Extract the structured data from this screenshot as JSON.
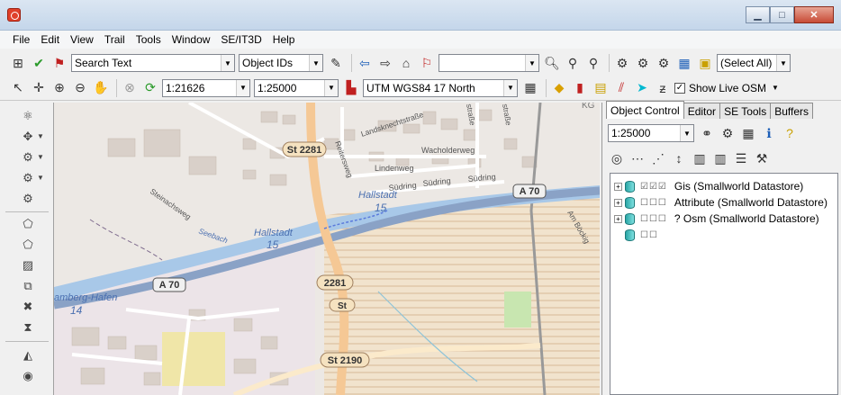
{
  "window": {
    "minimize_glyph": "▁",
    "maximize_glyph": "□",
    "close_glyph": "✕"
  },
  "menu": [
    "File",
    "Edit",
    "View",
    "Trail",
    "Tools",
    "Window",
    "SE/IT3D",
    "Help"
  ],
  "toolbar1": {
    "search_value": "Search Text",
    "object_ids": "Object IDs",
    "select_all": "(Select All)"
  },
  "toolbar2": {
    "scale1": "1:21626",
    "scale2": "1:25000",
    "crs": "UTM WGS84 17 North",
    "show_live_osm": "Show Live OSM"
  },
  "panel": {
    "tabs": [
      "Object Control",
      "Editor",
      "SE Tools",
      "Buffers"
    ],
    "scale": "1:25000",
    "tree": [
      {
        "label": "Gis (Smallworld Datastore)",
        "checks": "☑☑☑"
      },
      {
        "label": "Attribute (Smallworld Datastore)",
        "checks": "☐☐☐"
      },
      {
        "label": "? Osm (Smallworld Datastore)",
        "checks": "☐☐☐"
      },
      {
        "label": "",
        "checks": "☐☐"
      }
    ]
  },
  "map": {
    "labels": {
      "st2281_top": "St 2281",
      "st2281_mid": "2281",
      "st2190": "St 2190",
      "st_partial": "St",
      "a70_left": "A 70",
      "a70_right": "A 70",
      "hallstadt_1": "Hallstadt",
      "km15_1": "15",
      "hallstadt_2": "Hallstadt",
      "km15_2": "15",
      "bamberg_hafen": "amberg-Hafen",
      "km14": "14",
      "landsknecht": "Landsknechtstraße",
      "wacholderweg": "Wacholderweg",
      "lindenweg": "Lindenweg",
      "suedring_1": "Südring",
      "suedring_2": "Südring",
      "suedring_3": "Südring",
      "reitersweg": "Reitersweg",
      "sandstrasse": "straße",
      "am_bocksg": "Am Böckig",
      "strasse_right": "straße",
      "kg": "KG",
      "steinachweg": "Steinachsweg",
      "seebach": "Seebach"
    }
  },
  "colors": {
    "water": "#a8c8e8",
    "motorway": "#8aa2c6",
    "primary": "#f5c895",
    "farmland": "#f0e0c8",
    "residential": "#e2dedb"
  }
}
